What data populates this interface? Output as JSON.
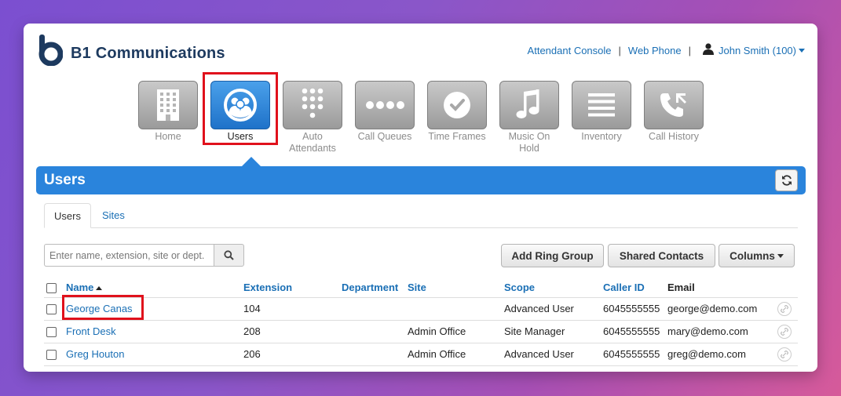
{
  "brand": {
    "name": "B1 Communications",
    "logo_letter": "b"
  },
  "topnav": {
    "attendant_console": "Attendant Console",
    "separator": "|",
    "web_phone": "Web Phone",
    "user": "John Smith (100)"
  },
  "apps": [
    {
      "label": "Home",
      "icon": "building-icon"
    },
    {
      "label": "Users",
      "icon": "users-icon",
      "active": true
    },
    {
      "label": "Auto Attendants",
      "icon": "keypad-icon"
    },
    {
      "label": "Call Queues",
      "icon": "dots-icon"
    },
    {
      "label": "Time Frames",
      "icon": "clock-icon"
    },
    {
      "label": "Music On Hold",
      "icon": "music-note-icon"
    },
    {
      "label": "Inventory",
      "icon": "list-icon"
    },
    {
      "label": "Call History",
      "icon": "call-history-icon"
    }
  ],
  "panel": {
    "title": "Users"
  },
  "tabs": {
    "users": "Users",
    "sites": "Sites"
  },
  "search": {
    "placeholder": "Enter name, extension, site or dept."
  },
  "buttons": {
    "add_ring_group": "Add Ring Group",
    "shared_contacts": "Shared Contacts",
    "columns": "Columns"
  },
  "table": {
    "headers": {
      "name": "Name",
      "extension": "Extension",
      "department": "Department",
      "site": "Site",
      "scope": "Scope",
      "caller_id": "Caller ID",
      "email": "Email"
    },
    "rows": [
      {
        "name": "George Canas",
        "extension": "104",
        "department": "",
        "site": "",
        "scope": "Advanced User",
        "caller_id": "6045555555",
        "email": "george@demo.com"
      },
      {
        "name": "Front Desk",
        "extension": "208",
        "department": "",
        "site": "Admin Office",
        "scope": "Site Manager",
        "caller_id": "6045555555",
        "email": "mary@demo.com"
      },
      {
        "name": "Greg Houton",
        "extension": "206",
        "department": "",
        "site": "Admin Office",
        "scope": "Advanced User",
        "caller_id": "6045555555",
        "email": "greg@demo.com"
      }
    ]
  },
  "colors": {
    "accent": "#2a84dc",
    "highlight": "#e0111c",
    "link": "#1a6fb5"
  }
}
